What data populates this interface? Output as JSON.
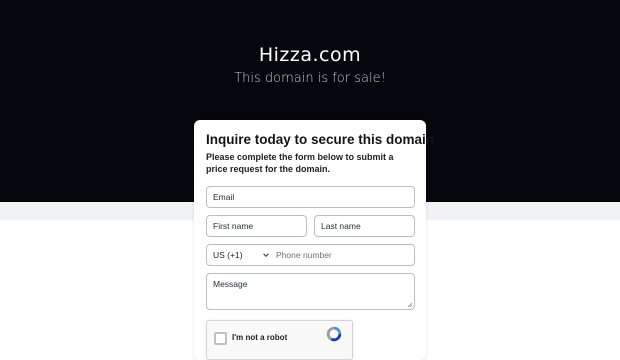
{
  "hero": {
    "title": "Hizza.com",
    "subtitle": "This domain is for sale!"
  },
  "form": {
    "heading": "Inquire today to secure this domain",
    "description": "Please complete the form below to submit a price request for the domain.",
    "email_placeholder": "Email",
    "first_name_placeholder": "First name",
    "last_name_placeholder": "Last name",
    "country_code": "US (+1)",
    "phone_placeholder": "Phone number",
    "message_placeholder": "Message"
  },
  "captcha": {
    "label": "I'm not a robot",
    "icon": "recaptcha-logo-icon"
  },
  "colors": {
    "hero_bg": "#05070c",
    "band_bg": "#f1f2f4",
    "card_bg": "#ffffff"
  }
}
